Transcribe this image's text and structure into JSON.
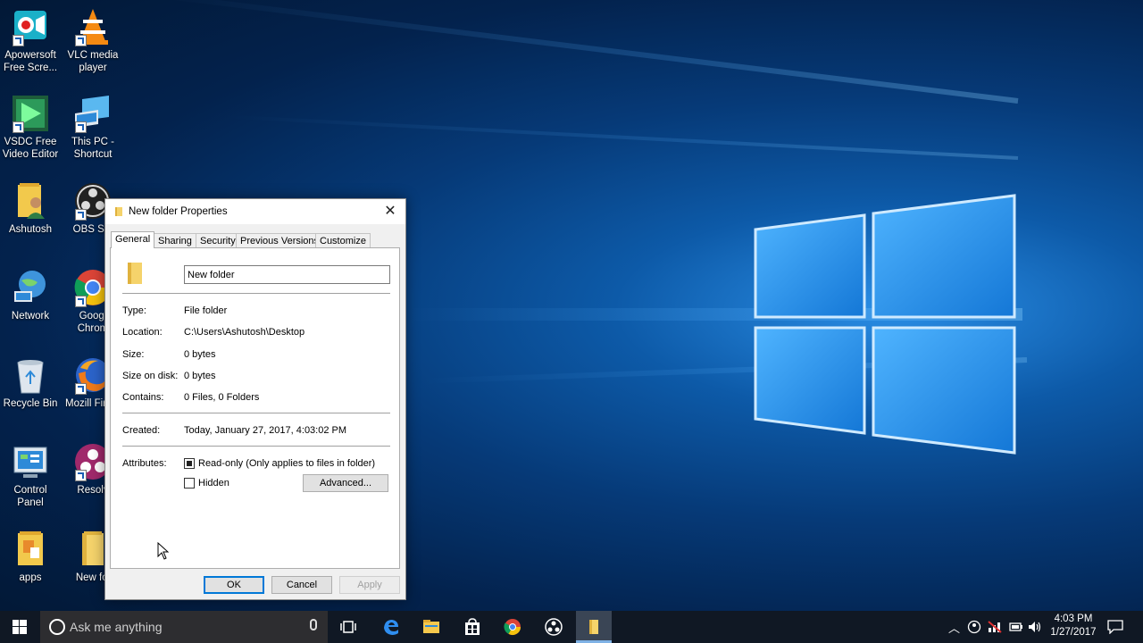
{
  "desktop": {
    "icons": [
      {
        "label": "Apowersoft Free Scre...",
        "icon": "apowersoft-icon"
      },
      {
        "label": "VLC media player",
        "icon": "vlc-icon"
      },
      {
        "label": "VSDC Free Video Editor",
        "icon": "vsdc-icon"
      },
      {
        "label": "This PC - Shortcut",
        "icon": "this-pc-icon"
      },
      {
        "label": "Ashutosh",
        "icon": "user-folder-icon"
      },
      {
        "label": "OBS Stu",
        "icon": "obs-icon"
      },
      {
        "label": "Network",
        "icon": "network-icon"
      },
      {
        "label": "Googl Chrom",
        "icon": "chrome-icon"
      },
      {
        "label": "Recycle Bin",
        "icon": "recycle-bin-icon"
      },
      {
        "label": "Mozill Firefo",
        "icon": "firefox-icon"
      },
      {
        "label": "Control Panel",
        "icon": "control-panel-icon"
      },
      {
        "label": "Resolv",
        "icon": "resolve-icon"
      },
      {
        "label": "apps",
        "icon": "apps-folder-icon"
      },
      {
        "label": "New fol",
        "icon": "folder-icon"
      }
    ]
  },
  "dialog": {
    "title": "New folder Properties",
    "tabs": [
      "General",
      "Sharing",
      "Security",
      "Previous Versions",
      "Customize"
    ],
    "active_tab": "General",
    "name_value": "New folder",
    "properties": {
      "type_label": "Type:",
      "type_value": "File folder",
      "location_label": "Location:",
      "location_value": "C:\\Users\\Ashutosh\\Desktop",
      "size_label": "Size:",
      "size_value": "0 bytes",
      "size_on_disk_label": "Size on disk:",
      "size_on_disk_value": "0 bytes",
      "contains_label": "Contains:",
      "contains_value": "0 Files, 0 Folders",
      "created_label": "Created:",
      "created_value": "Today, January 27, 2017, 4:03:02 PM",
      "attributes_label": "Attributes:"
    },
    "attributes": {
      "readonly_label": "Read-only (Only applies to files in folder)",
      "hidden_label": "Hidden",
      "advanced_button": "Advanced..."
    },
    "buttons": {
      "ok": "OK",
      "cancel": "Cancel",
      "apply": "Apply"
    }
  },
  "taskbar": {
    "search_placeholder": "Ask me anything",
    "clock_time": "4:03 PM",
    "clock_date": "1/27/2017"
  },
  "colors": {
    "accent": "#0078d7",
    "taskbar": "#101824"
  }
}
